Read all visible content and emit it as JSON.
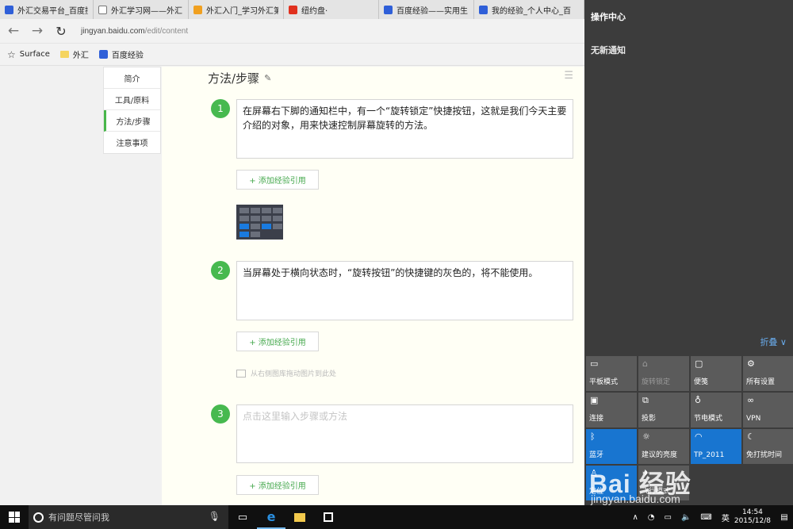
{
  "tabs": [
    {
      "title": "外汇交易平台_百度搜",
      "icon": "baidu"
    },
    {
      "title": "外汇学习网——外汇",
      "icon": "page"
    },
    {
      "title": "外汇入门_学习外汇第",
      "icon": "orange"
    },
    {
      "title": "纽约盘·",
      "icon": "red"
    },
    {
      "title": "百度经验——实用生",
      "icon": "baidu"
    },
    {
      "title": "我的经验_个人中心_百",
      "icon": "baidu"
    }
  ],
  "address": {
    "domain": "jingyan.baidu.com",
    "path": "/edit/content"
  },
  "favorites": [
    {
      "label": "Surface",
      "icon": "star-icon"
    },
    {
      "label": "外汇",
      "icon": "folder-icon"
    },
    {
      "label": "百度经验",
      "icon": "paw-icon"
    }
  ],
  "left_nav": [
    "简介",
    "工具/原料",
    "方法/步骤",
    "注意事项"
  ],
  "section_title": "方法/步骤",
  "steps": [
    {
      "num": "1",
      "text": "在屏幕右下脚的通知栏中，有一个“旋转锁定”快捷按钮，这就是我们今天主要介绍的对象，用来快速控制屏幕旋转的方法。"
    },
    {
      "num": "2",
      "text": "当屏幕处于横向状态时，“旋转按钮”的快捷键的灰色的，将不能使用。"
    },
    {
      "num": "3",
      "placeholder": "点击这里输入步骤或方法"
    }
  ],
  "add_ref_label": "+ 添加经验引用",
  "drag_hint": "从右侧图库拖动图片到此处",
  "action_center": {
    "title": "操作中心",
    "no_notifications": "无新通知",
    "collapse": "折叠 ∨",
    "tiles": [
      {
        "label": "平板模式",
        "icon": "tablet-icon",
        "state": "off"
      },
      {
        "label": "旋转锁定",
        "icon": "rotation-lock-icon",
        "state": "disabled"
      },
      {
        "label": "便笺",
        "icon": "note-icon",
        "state": "off"
      },
      {
        "label": "所有设置",
        "icon": "gear-icon",
        "state": "off"
      },
      {
        "label": "连接",
        "icon": "connect-icon",
        "state": "off"
      },
      {
        "label": "投影",
        "icon": "project-icon",
        "state": "off"
      },
      {
        "label": "节电模式",
        "icon": "battery-saver-icon",
        "state": "off"
      },
      {
        "label": "VPN",
        "icon": "vpn-icon",
        "state": "off"
      },
      {
        "label": "蓝牙",
        "icon": "bluetooth-icon",
        "state": "on"
      },
      {
        "label": "建议的亮度",
        "icon": "brightness-icon",
        "state": "off"
      },
      {
        "label": "TP_2011",
        "icon": "wifi-icon",
        "state": "on"
      },
      {
        "label": "免打扰时间",
        "icon": "moon-icon",
        "state": "off"
      },
      {
        "label": "定位",
        "icon": "location-icon",
        "state": "on"
      },
      {
        "label": "飞行模式",
        "icon": "airplane-icon",
        "state": "off"
      }
    ]
  },
  "watermark": {
    "text": "Bai 经验",
    "url": "jingyan.baidu.com"
  },
  "taskbar": {
    "search_placeholder": "有问题尽管问我",
    "ime": "英",
    "time": "14:54",
    "date": "2015/12/8"
  },
  "colors": {
    "accent_green": "#47b94f",
    "tile_on": "#1875d0",
    "action_center_bg": "#3c3c3c",
    "taskbar_bg": "#101010"
  }
}
